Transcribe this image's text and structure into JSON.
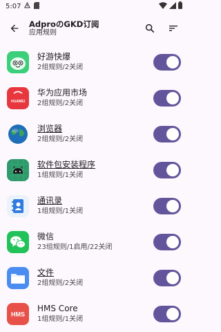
{
  "status_bar": {
    "time": "5:07"
  },
  "header": {
    "title": "AdproのGKD订阅",
    "subtitle": "应用规则"
  },
  "apps": [
    {
      "name": "好游快爆",
      "rules": "2组规则/2关闭",
      "underline": false,
      "enabled": true
    },
    {
      "name": "华为应用市场",
      "rules": "2组规则/2关闭",
      "underline": false,
      "enabled": true,
      "icon_text": "HUAWEI"
    },
    {
      "name": "浏览器",
      "rules": "2组规则/2关闭",
      "underline": true,
      "enabled": true
    },
    {
      "name": "软件包安装程序",
      "rules": "1组规则/1关闭",
      "underline": true,
      "enabled": true
    },
    {
      "name": "通讯录",
      "rules": "1组规则/1关闭",
      "underline": true,
      "enabled": true
    },
    {
      "name": "微信",
      "rules": "23组规则/1启用/22关闭",
      "underline": false,
      "enabled": true
    },
    {
      "name": "文件",
      "rules": "2组规则/2关闭",
      "underline": true,
      "enabled": true
    },
    {
      "name": "HMS Core",
      "rules": "1组规则/1关闭",
      "underline": false,
      "enabled": true,
      "icon_text": "HMS"
    }
  ],
  "colors": {
    "toggle_on": "#63559b",
    "background": "#fdf8fd"
  }
}
